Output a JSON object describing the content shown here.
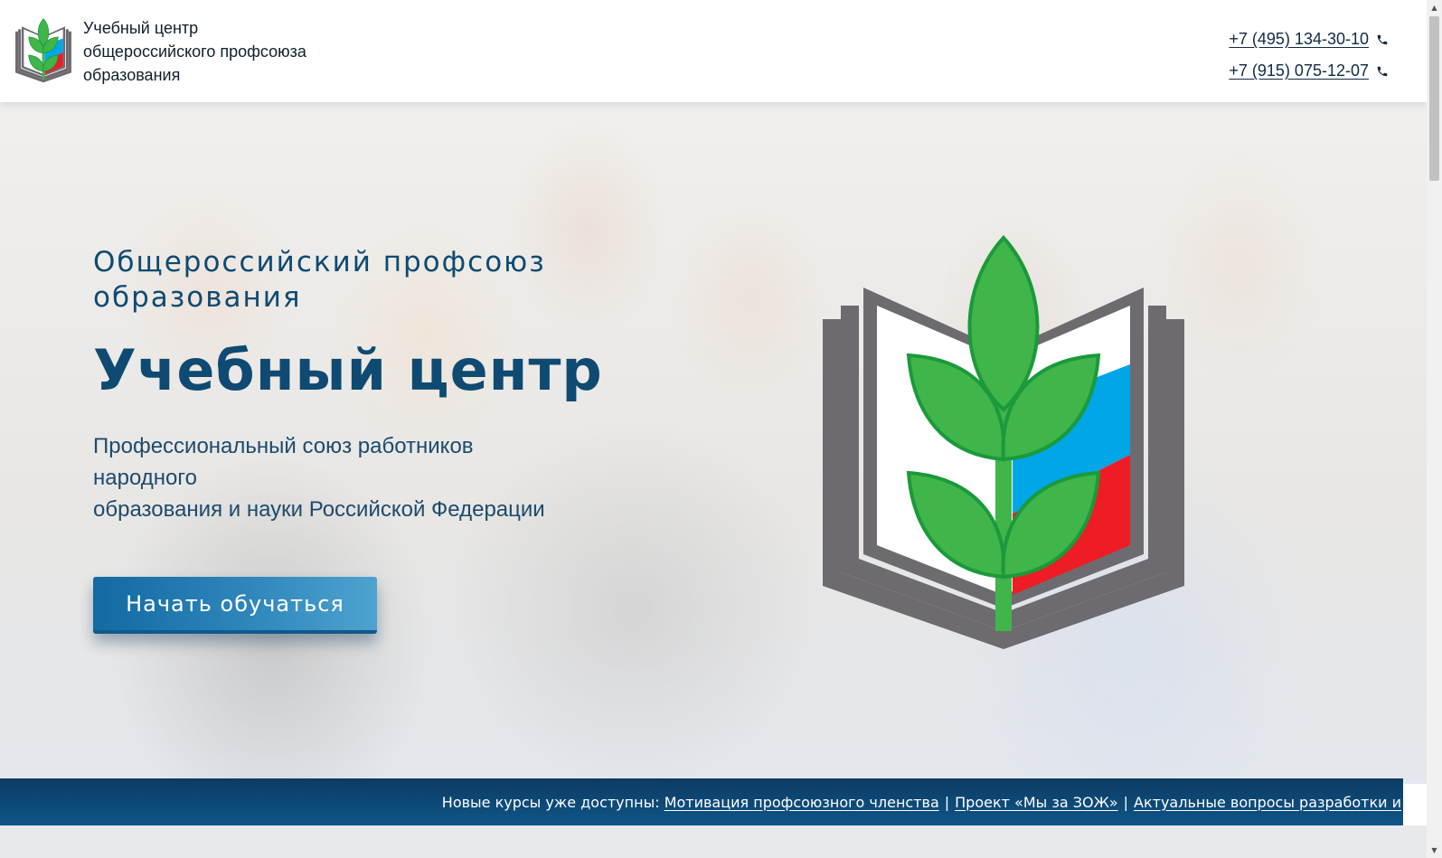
{
  "header": {
    "brand_lines": [
      "Учебный центр",
      "общероссийского профсоюза",
      "образования"
    ],
    "phones": [
      "+7 (495) 134-30-10",
      "+7 (915) 075-12-07"
    ],
    "phone_icon": "phone-icon"
  },
  "hero": {
    "subtitle_line1": "Общероссийский профсоюз",
    "subtitle_line2": "образования",
    "title": "Учебный центр",
    "description_line1": "Профессиональный союз работников народного",
    "description_line2": "образования и науки Российской Федерации",
    "cta_label": "Начать обучаться"
  },
  "ticker": {
    "prefix": "Новые курсы уже доступны:",
    "links": [
      "Мотивация профсоюзного членства",
      "Проект «Мы за ЗОЖ»",
      "Актуальные вопросы разработки и"
    ],
    "separator": "|"
  },
  "colors": {
    "primary": "#0e4a72",
    "button": "#2e86bb",
    "ticker_bg": "#0f5689",
    "emblem_green": "#3fb54a",
    "flag_blue": "#00a6e6",
    "flag_red": "#ee1c25",
    "book_gray": "#6e6b70"
  }
}
